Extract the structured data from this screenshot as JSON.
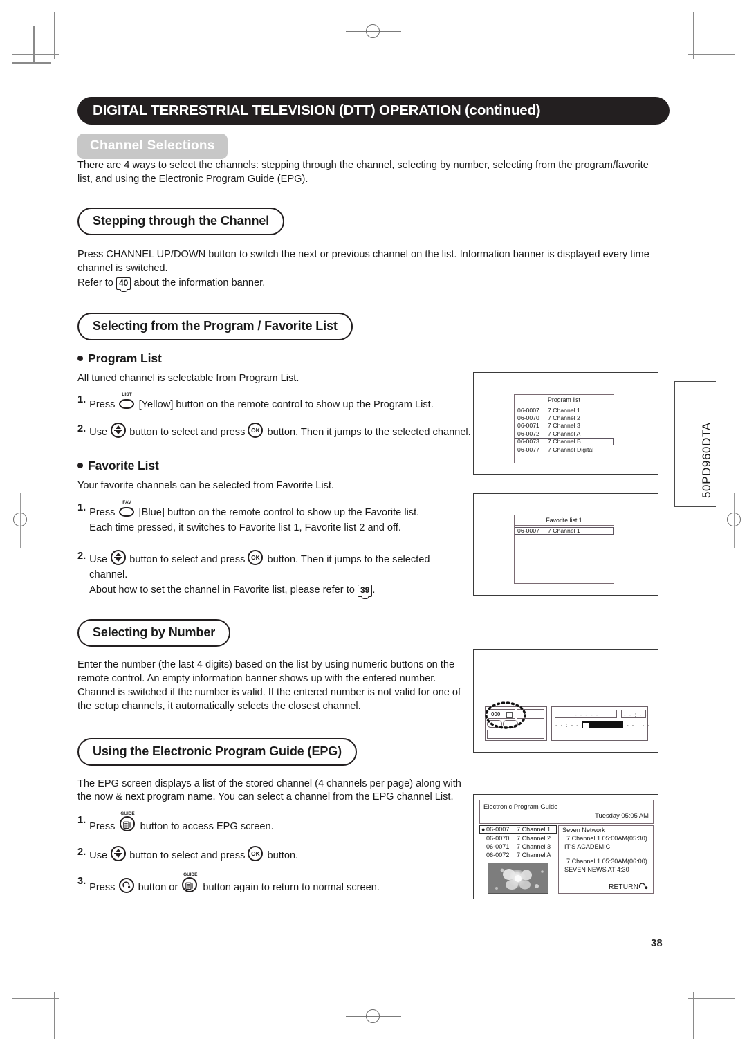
{
  "header": {
    "title": "DIGITAL TERRESTRIAL TELEVISION (DTT) OPERATION (continued)",
    "subtitle": "Channel Selections"
  },
  "intro": "There are 4 ways to select the channels: stepping through the channel, selecting by number, selecting from the program/favorite list, and using the Electronic Program Guide (EPG).",
  "sections": {
    "stepping": {
      "heading": "Stepping through the Channel",
      "para1": "Press CHANNEL UP/DOWN button to switch the next or previous channel on the list. Information banner is displayed every time channel is switched.",
      "refer_pre": "Refer to",
      "refer_page": "40",
      "refer_post": "about the information banner."
    },
    "program_favorite": {
      "heading": "Selecting from the Program / Favorite List",
      "program_list": {
        "heading": "Program List",
        "para": "All tuned channel is selectable from Program List.",
        "step1_num": "1.",
        "step1_a": "Press",
        "step1_key": "LIST",
        "step1_b": "[Yellow] button on the remote control to show up the Program List.",
        "step2_num": "2.",
        "step2_a": "Use",
        "step2_b": "button to select and press",
        "step2_ok": "OK",
        "step2_c": "button. Then it jumps to the selected channel."
      },
      "favorite_list": {
        "heading": "Favorite List",
        "para": "Your favorite channels can be selected from Favorite List.",
        "step1_num": "1.",
        "step1_a": "Press",
        "step1_key": "FAV",
        "step1_b": "[Blue] button on the remote control to show up the Favorite list.",
        "step1_c": "Each time pressed, it switches to Favorite list 1, Favorite list 2 and off.",
        "step2_num": "2.",
        "step2_a": "Use",
        "step2_b": "button to select and press",
        "step2_ok": "OK",
        "step2_c": "button. Then it jumps to the selected channel.",
        "step2_d_pre": "About how to set the channel in Favorite list, please refer to",
        "step2_d_page": "39",
        "step2_d_post": "."
      }
    },
    "by_number": {
      "heading": "Selecting by Number",
      "para": "Enter the number (the last 4 digits) based on the list by using numeric buttons on the remote control. An empty information banner shows up with the entered number. Channel is switched if the number is valid. If the entered number is not valid for one of the setup channels, it automatically selects the closest channel."
    },
    "epg": {
      "heading": "Using the Electronic Program Guide (EPG)",
      "para": "The EPG screen displays a list of the stored channel (4 channels per page) along with the now & next program name. You can select a channel from the EPG channel List.",
      "step1_num": "1.",
      "step1_a": "Press",
      "step1_key": "GUIDE",
      "step1_b": "button to access EPG screen.",
      "step2_num": "2.",
      "step2_a": "Use",
      "step2_b": "button to select and press",
      "step2_ok": "OK",
      "step2_c": "button.",
      "step3_num": "3.",
      "step3_a": "Press",
      "step3_b": "button or",
      "step3_key": "GUIDE",
      "step3_c": "button again to return to normal screen."
    }
  },
  "figures": {
    "program_list": {
      "title": "Program list",
      "rows": [
        {
          "channel": "06-0007",
          "name": "7 Channel 1",
          "selected": false
        },
        {
          "channel": "06-0070",
          "name": "7 Channel 2",
          "selected": false
        },
        {
          "channel": "06-0071",
          "name": "7 Channel 3",
          "selected": false
        },
        {
          "channel": "06-0072",
          "name": "7 Channel A",
          "selected": false
        },
        {
          "channel": "06-0073",
          "name": "7 Channel B",
          "selected": true
        },
        {
          "channel": "06-0077",
          "name": "7 Channel Digital",
          "selected": false
        }
      ]
    },
    "favorite_list": {
      "title": "Favorite list 1",
      "rows": [
        {
          "channel": "06-0007",
          "name": "7 Channel 1",
          "selected": true
        }
      ]
    },
    "banner": {
      "number": "000",
      "placeholder_text": "- - - - -",
      "placeholder_time": "- - : - -"
    },
    "epg": {
      "title": "Electronic Program Guide",
      "datetime": "Tuesday 05:05 AM",
      "channels": [
        {
          "marker": "●",
          "channel": "06-0007",
          "name": "7 Channel 1",
          "selected": true
        },
        {
          "marker": "",
          "channel": "06-0070",
          "name": "7 Channel 2",
          "selected": false
        },
        {
          "marker": "",
          "channel": "06-0071",
          "name": "7 Channel 3",
          "selected": false
        },
        {
          "marker": "",
          "channel": "06-0072",
          "name": "7 Channel A",
          "selected": false
        }
      ],
      "network": "Seven Network",
      "now_line": "7 Channel 1   05:00AM(05:30)",
      "now_title": "IT’S ACADEMIC",
      "next_line": "7 Channel 1   05:30AM(06:00)",
      "next_title": "SEVEN NEWS AT 4:30",
      "return_label": "RETURN"
    }
  },
  "model_label": "50PD960DTA",
  "page_number": "38"
}
